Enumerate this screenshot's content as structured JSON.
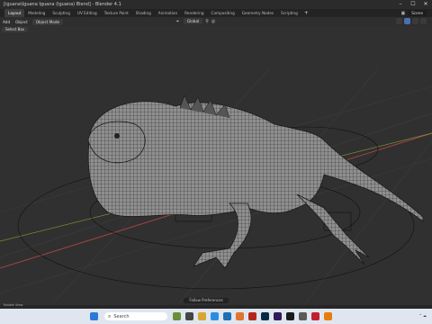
{
  "window": {
    "title": "[iguana\\Iguana Iguana (Iguana) Blend] - Blender 4.1",
    "controls": [
      "–",
      "☐",
      "✕"
    ]
  },
  "workspace_tabs": [
    "Layout",
    "Modeling",
    "Sculpting",
    "UV Editing",
    "Texture Paint",
    "Shading",
    "Animation",
    "Rendering",
    "Compositing",
    "Geometry Nodes",
    "Scripting"
  ],
  "active_tab": "Layout",
  "tab_add": "+",
  "scene": {
    "label": "Scene"
  },
  "header": {
    "menus": [
      "Add",
      "Object"
    ],
    "mode": "Object Mode",
    "transform": "Global",
    "select_mode": "Select Box"
  },
  "viewport": {
    "status": "Follow Preferences"
  },
  "statusbar": {
    "left": "Rotate View"
  },
  "taskbar": {
    "search_placeholder": "Search"
  },
  "colors": {
    "bg": "#303030",
    "accent": "#4772b3"
  }
}
